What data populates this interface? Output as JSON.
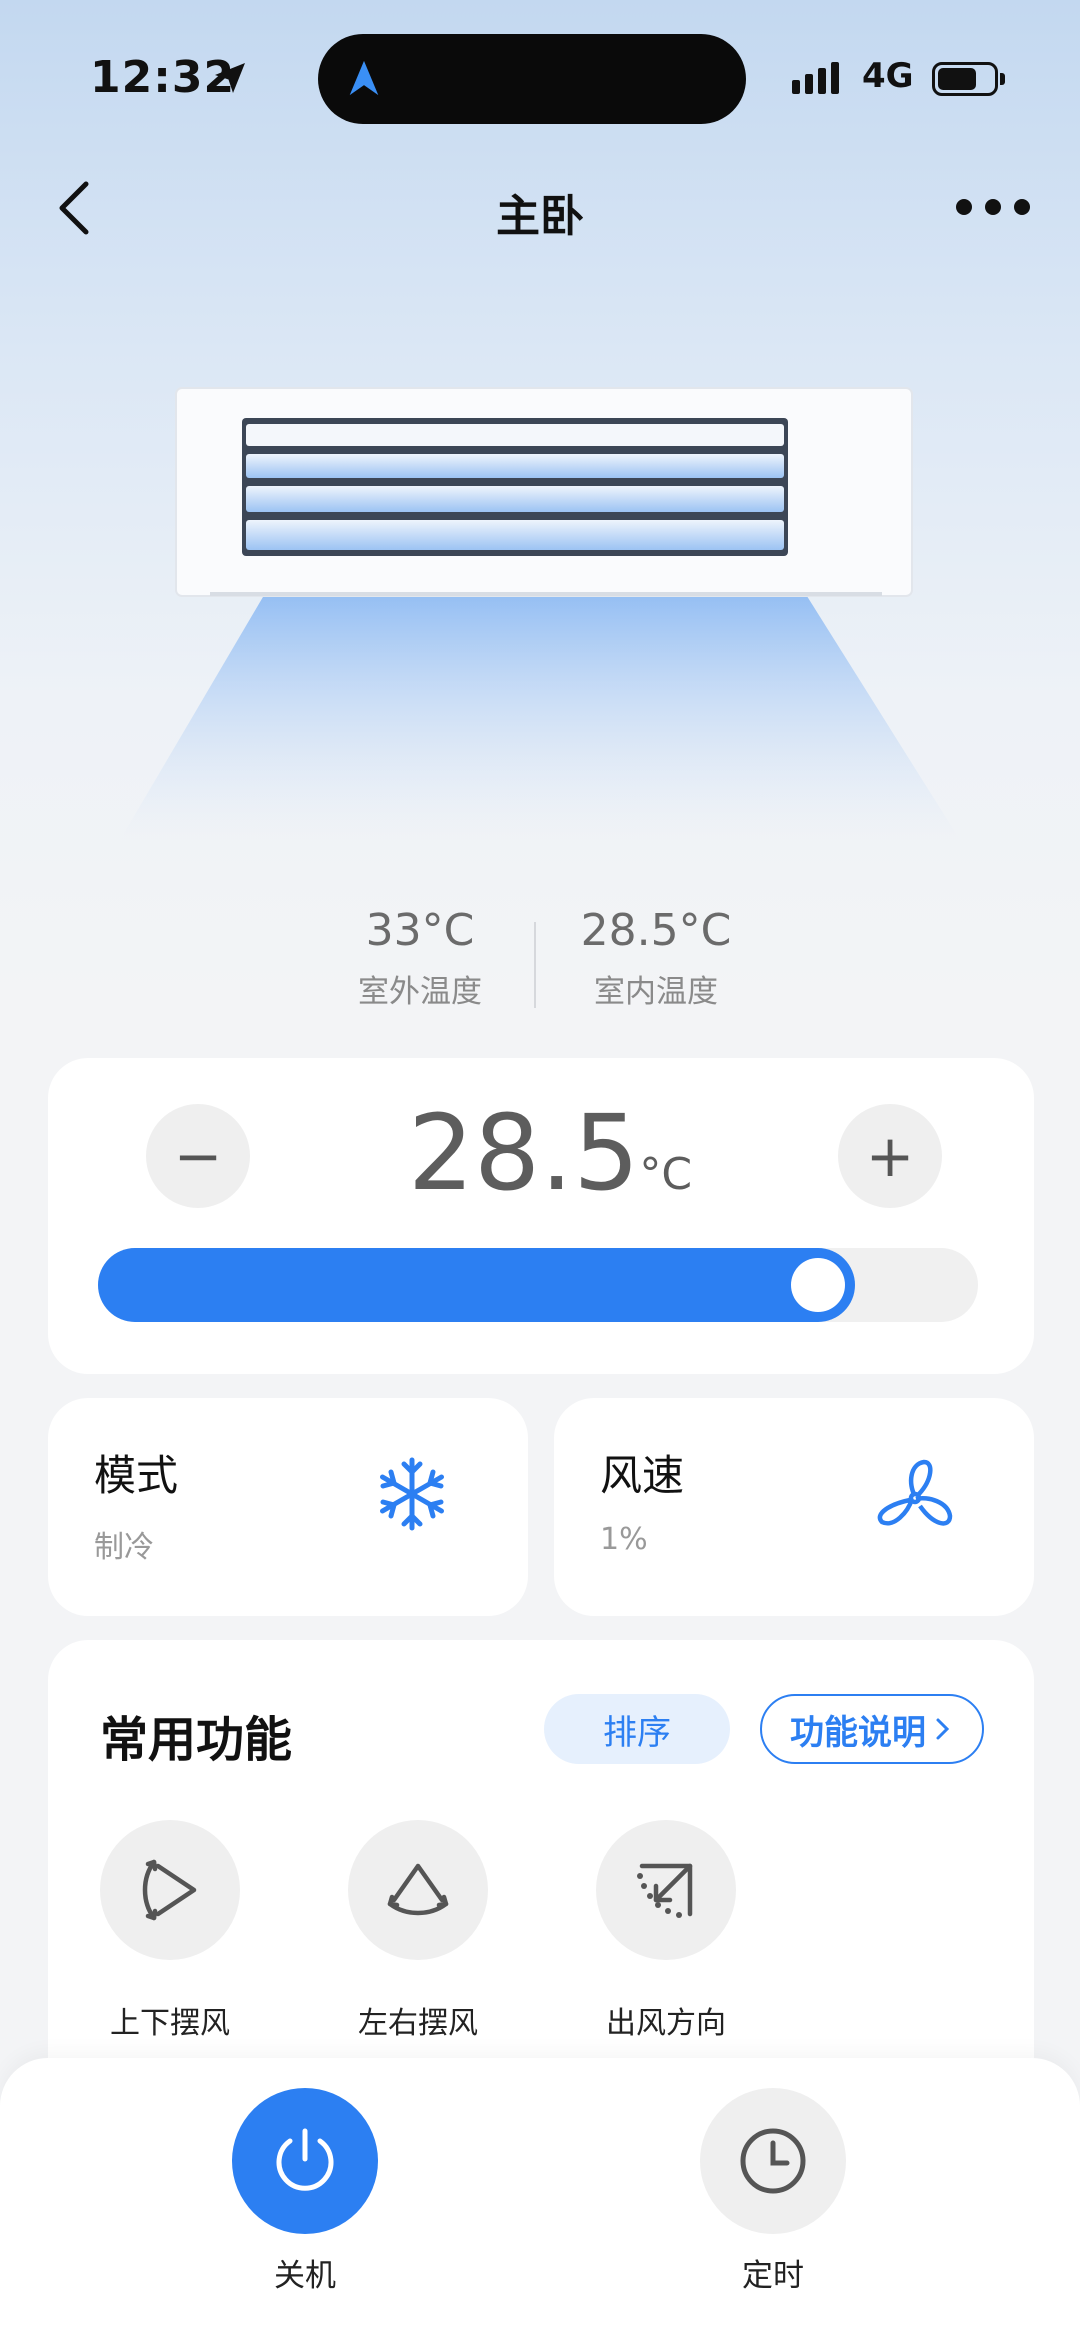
{
  "status_bar": {
    "time": "12:32",
    "network": "4G"
  },
  "header": {
    "title": "主卧"
  },
  "temps": {
    "outdoor_value": "33°C",
    "outdoor_label": "室外温度",
    "indoor_value": "28.5°C",
    "indoor_label": "室内温度"
  },
  "setpoint": {
    "value": "28.5",
    "unit": "°C",
    "minus_label": "−",
    "plus_label": "+",
    "slider_fraction": 0.86
  },
  "mode": {
    "title": "模式",
    "value": "制冷",
    "icon": "snowflake-icon"
  },
  "wind": {
    "title": "风速",
    "value": "1%",
    "icon": "fan-icon"
  },
  "functions": {
    "title": "常用功能",
    "sort_label": "排序",
    "help_label": "功能说明",
    "items": [
      {
        "label": "上下摆风",
        "icon": "vertical-swing-icon"
      },
      {
        "label": "左右摆风",
        "icon": "horizontal-swing-icon"
      },
      {
        "label": "出风方向",
        "icon": "airflow-direction-icon"
      }
    ]
  },
  "bottom": {
    "power_label": "关机",
    "timer_label": "定时"
  },
  "colors": {
    "accent": "#2c7ff2",
    "card": "#ffffff",
    "muted_button": "#efefef"
  }
}
